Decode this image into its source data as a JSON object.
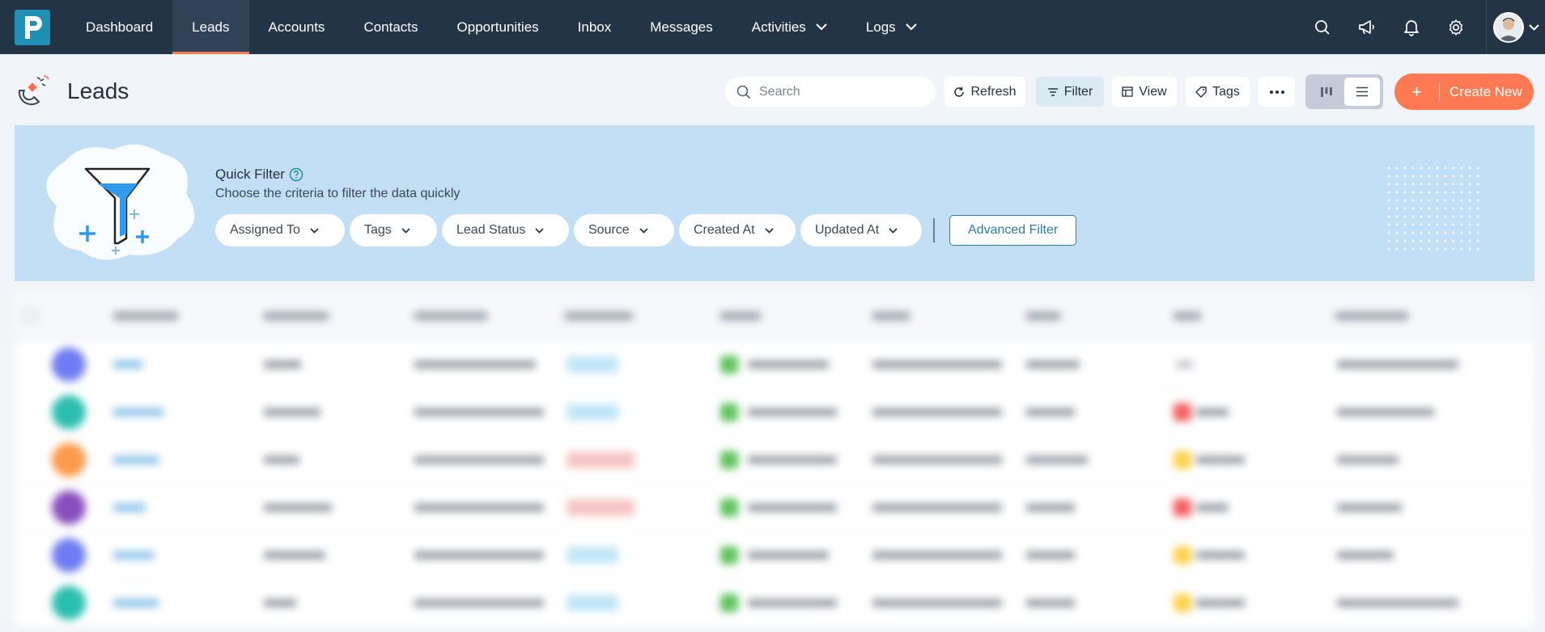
{
  "nav": {
    "items": [
      {
        "label": "Dashboard"
      },
      {
        "label": "Leads"
      },
      {
        "label": "Accounts"
      },
      {
        "label": "Contacts"
      },
      {
        "label": "Opportunities"
      },
      {
        "label": "Inbox"
      },
      {
        "label": "Messages"
      },
      {
        "label": "Activities"
      },
      {
        "label": "Logs"
      }
    ],
    "active": "Leads"
  },
  "header": {
    "title": "Leads",
    "search_placeholder": "Search",
    "refresh_label": "Refresh",
    "filter_label": "Filter",
    "view_label": "View",
    "tags_label": "Tags",
    "create_label": "Create New"
  },
  "quick_filter": {
    "title": "Quick Filter",
    "subtitle": "Choose the criteria to filter the data quickly",
    "chips": [
      {
        "label": "Assigned To"
      },
      {
        "label": "Tags"
      },
      {
        "label": "Lead Status"
      },
      {
        "label": "Source"
      },
      {
        "label": "Created At"
      },
      {
        "label": "Updated At"
      }
    ],
    "advanced_label": "Advanced Filter"
  },
  "colors": {
    "topbar": "#243447",
    "accent": "#ff7a52",
    "quick_filter_bg": "#c3dff6",
    "link": "#2a7f9a"
  }
}
